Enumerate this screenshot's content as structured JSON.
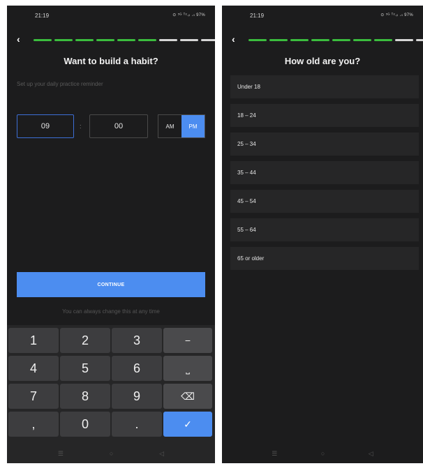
{
  "left_screen": {
    "status": {
      "time": "21:19",
      "icons": "⊙ ⁵ᴳ ᵀᵒ.ᵢₗ .ₗₗ 97%"
    },
    "progress": {
      "total": 10,
      "filled": 6
    },
    "title": "Want to build a habit?",
    "subtitle": "Set up your daily practice reminder",
    "time_input": {
      "hour": "09",
      "separator": ":",
      "minute": "00",
      "am": "AM",
      "pm": "PM",
      "selected": "PM"
    },
    "continue_label": "CONTINUE",
    "hint": "You can always change this at any time",
    "keys": [
      "1",
      "2",
      "3",
      "−",
      "4",
      "5",
      "6",
      "⎵",
      "7",
      "8",
      "9",
      "⌫",
      ",",
      "0",
      ".",
      "✓"
    ],
    "nav": [
      "☰",
      "○",
      "◁"
    ]
  },
  "right_screen": {
    "status": {
      "time": "21:19",
      "icons": "⊙ ⁵ᴳ ᵀᵒ.ᵢₗ .ₗₗ 97%"
    },
    "progress": {
      "total": 10,
      "filled": 7
    },
    "title": "How old are you?",
    "options": [
      "Under 18",
      "18 – 24",
      "25 – 34",
      "35 – 44",
      "45 – 54",
      "55 – 64",
      "65 or older"
    ],
    "nav": [
      "☰",
      "○",
      "◁"
    ]
  },
  "colors": {
    "accent": "#4c8df0",
    "progress_on": "#3bbd3e",
    "background": "#1c1c1d"
  }
}
